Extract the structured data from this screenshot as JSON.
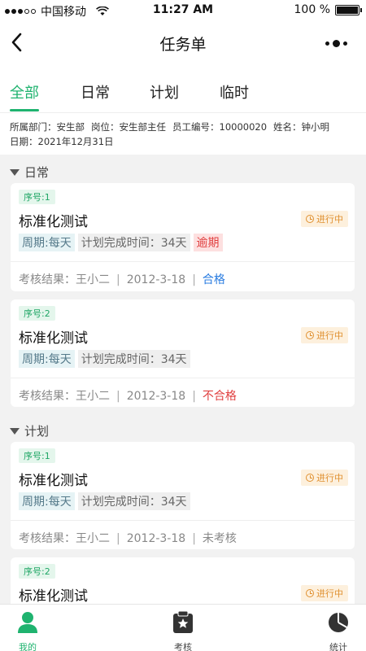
{
  "status": {
    "carrier": "中国移动",
    "time": "11:27 AM",
    "battery": "100 %",
    "battery_level": 1.0
  },
  "nav": {
    "title": "任务单"
  },
  "tabs": [
    {
      "label": "全部"
    },
    {
      "label": "日常"
    },
    {
      "label": "计划"
    },
    {
      "label": "临时"
    }
  ],
  "info": {
    "dept": "所属部门：安生部",
    "post": "岗位：安生部主任",
    "emp_no": "员工编号：10000020",
    "name": "姓名：钟小明",
    "date": "日期：2021年12月31日"
  },
  "sections": {
    "daily": {
      "title": "日常"
    },
    "plan": {
      "title": "计划"
    }
  },
  "cards": [
    {
      "seq": "序号:1",
      "title": "标准化测试",
      "status": "进行中",
      "period": "周期:每天",
      "plan_time": "计划完成时间：34天",
      "overdue": "逾期",
      "result_label": "考核结果：王小二",
      "date": "2012-3-18",
      "result": "合格"
    },
    {
      "seq": "序号:2",
      "title": "标准化测试",
      "status": "进行中",
      "period": "周期:每天",
      "plan_time": "计划完成时间：34天",
      "result_label": "考核结果：王小二",
      "date": "2012-3-18",
      "result": "不合格"
    },
    {
      "seq": "序号:1",
      "title": "标准化测试",
      "status": "进行中",
      "period": "周期:每天",
      "plan_time": "计划完成时间：34天",
      "result_label": "考核结果：王小二",
      "date": "2012-3-18",
      "result": "未考核"
    },
    {
      "seq": "序号:2",
      "title": "标准化测试",
      "status": "进行中"
    }
  ],
  "bottom": [
    {
      "label": "我的"
    },
    {
      "label": "考核"
    },
    {
      "label": "统计"
    }
  ],
  "colors": {
    "accent": "#1fb36f",
    "warning": "#e09030",
    "danger": "#e04040",
    "link": "#2a7ce0"
  },
  "icons": {
    "back": "chevron-left-icon",
    "more": "more-dots-icon",
    "wifi": "wifi-icon",
    "battery": "battery-icon",
    "status": "clock-icon",
    "mine": "user-icon",
    "assess": "clipboard-star-icon",
    "stats": "pie-chart-icon"
  }
}
